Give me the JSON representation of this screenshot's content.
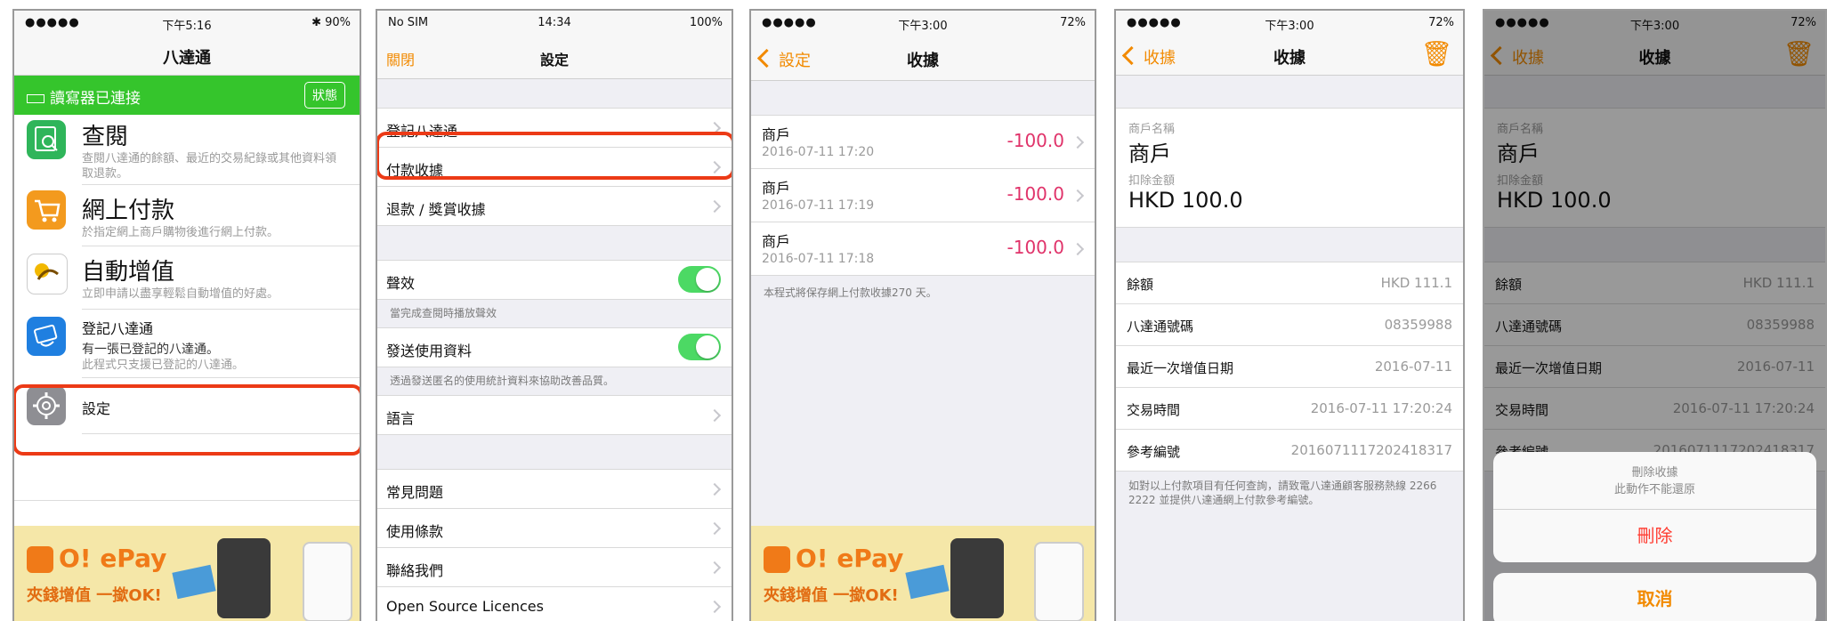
{
  "phone1": {
    "status": {
      "signal": "●●●●●",
      "time": "下午5:16",
      "battery": "✱ 90%"
    },
    "title": "八達通",
    "reader": {
      "text": "讀寫器已連接",
      "button": "狀態"
    },
    "items": [
      {
        "title": "查閱",
        "sub": "查閱八達通的餘額、最近的交易紀錄或其他資料領取退款。"
      },
      {
        "title": "網上付款",
        "sub": "於指定網上商戶購物後進行網上付款。"
      },
      {
        "title": "自動增值",
        "sub": "立即申請以盡享輕鬆自動增值的好處。"
      },
      {
        "title": "登記八達通",
        "sub1": "有一張已登記的八達通。",
        "sub2": "此程式只支援已登記的八達通。"
      },
      {
        "title": "設定"
      }
    ],
    "banner": {
      "brand": "O! ePay",
      "slogan": "夾錢增值 一撳OK!"
    }
  },
  "phone2": {
    "status": {
      "signal": "No SIM",
      "time": "14:34",
      "battery": "100%"
    },
    "left": "關閉",
    "title": "設定",
    "rows1": [
      "登記八達通",
      "付款收據",
      "退款 / 獎賞收據"
    ],
    "sound": "聲效",
    "sound_note": "當完成查閱時播放聲效",
    "send": "發送使用資料",
    "send_note": "透過發送匿名的使用統計資料來協助改善品質。",
    "lang": "語言",
    "rows2": [
      "常見問題",
      "使用條款",
      "聯絡我們",
      "Open Source Licences"
    ]
  },
  "phone3": {
    "status": {
      "signal": "●●●●●",
      "time": "下午3:00",
      "battery": "72%"
    },
    "back": "設定",
    "title": "收據",
    "receipts": [
      {
        "name": "商戶",
        "date": "2016-07-11 17:20",
        "amount": "-100.0"
      },
      {
        "name": "商戶",
        "date": "2016-07-11 17:19",
        "amount": "-100.0"
      },
      {
        "name": "商戶",
        "date": "2016-07-11 17:18",
        "amount": "-100.0"
      }
    ],
    "note": "本程式將保存網上付款收據270 天。",
    "banner": {
      "brand": "O! ePay",
      "slogan": "夾錢增值 一撳OK!"
    }
  },
  "phone4": {
    "status": {
      "signal": "●●●●●",
      "time": "下午3:00",
      "battery": "72%"
    },
    "back": "收據",
    "title": "收據",
    "merchant_label": "商戶名稱",
    "merchant": "商戶",
    "amount_label": "扣除金額",
    "amount": "HKD 100.0",
    "rows": [
      {
        "k": "餘額",
        "v": "HKD 111.1"
      },
      {
        "k": "八達通號碼",
        "v": "08359988"
      },
      {
        "k": "最近一次增值日期",
        "v": "2016-07-11"
      },
      {
        "k": "交易時間",
        "v": "2016-07-11 17:20:24"
      },
      {
        "k": "參考編號",
        "v": "20160711172024183​17"
      }
    ],
    "footnote": "如對以上付款項目有任何查詢，請致電八達通顧客服務熱線 2266 2222 並提供八達通網上付款參考編號。"
  },
  "phone5": {
    "status": {
      "signal": "●●●●●",
      "time": "下午3:00",
      "battery": "72%"
    },
    "back": "收據",
    "title": "收據",
    "merchant_label": "商戶名稱",
    "merchant": "商戶",
    "amount_label": "扣除金額",
    "amount": "HKD 100.0",
    "rows": [
      {
        "k": "餘額",
        "v": "HKD 111.1"
      },
      {
        "k": "八達通號碼",
        "v": "08359988"
      },
      {
        "k": "最近一次增值日期",
        "v": "2016-07-11"
      },
      {
        "k": "交易時間",
        "v": "2016-07-11 17:20:24"
      },
      {
        "k": "參考編號",
        "v": "201607111720241831​7"
      }
    ],
    "sheet": {
      "title": "刪除收據",
      "sub": "此動作不能還原",
      "delete": "刪除",
      "cancel": "取消"
    }
  },
  "colors": {
    "accent": "#f28a00",
    "green": "#35c52c",
    "amount": "#e0336a",
    "highlight": "#ec3a16"
  }
}
